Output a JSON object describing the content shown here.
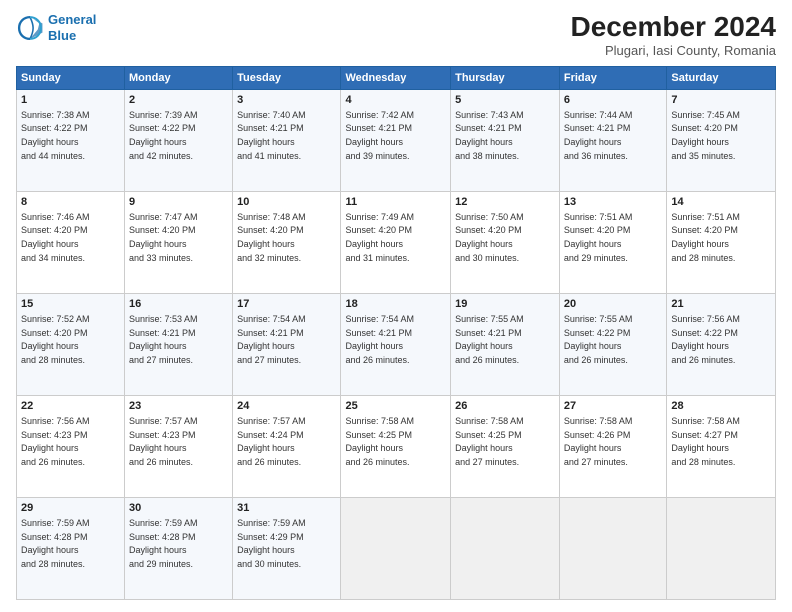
{
  "logo": {
    "line1": "General",
    "line2": "Blue"
  },
  "title": "December 2024",
  "subtitle": "Plugari, Iasi County, Romania",
  "header_days": [
    "Sunday",
    "Monday",
    "Tuesday",
    "Wednesday",
    "Thursday",
    "Friday",
    "Saturday"
  ],
  "weeks": [
    [
      {
        "day": "1",
        "sunrise": "7:38 AM",
        "sunset": "4:22 PM",
        "daylight": "8 hours and 44 minutes."
      },
      {
        "day": "2",
        "sunrise": "7:39 AM",
        "sunset": "4:22 PM",
        "daylight": "8 hours and 42 minutes."
      },
      {
        "day": "3",
        "sunrise": "7:40 AM",
        "sunset": "4:21 PM",
        "daylight": "8 hours and 41 minutes."
      },
      {
        "day": "4",
        "sunrise": "7:42 AM",
        "sunset": "4:21 PM",
        "daylight": "8 hours and 39 minutes."
      },
      {
        "day": "5",
        "sunrise": "7:43 AM",
        "sunset": "4:21 PM",
        "daylight": "8 hours and 38 minutes."
      },
      {
        "day": "6",
        "sunrise": "7:44 AM",
        "sunset": "4:21 PM",
        "daylight": "8 hours and 36 minutes."
      },
      {
        "day": "7",
        "sunrise": "7:45 AM",
        "sunset": "4:20 PM",
        "daylight": "8 hours and 35 minutes."
      }
    ],
    [
      {
        "day": "8",
        "sunrise": "7:46 AM",
        "sunset": "4:20 PM",
        "daylight": "8 hours and 34 minutes."
      },
      {
        "day": "9",
        "sunrise": "7:47 AM",
        "sunset": "4:20 PM",
        "daylight": "8 hours and 33 minutes."
      },
      {
        "day": "10",
        "sunrise": "7:48 AM",
        "sunset": "4:20 PM",
        "daylight": "8 hours and 32 minutes."
      },
      {
        "day": "11",
        "sunrise": "7:49 AM",
        "sunset": "4:20 PM",
        "daylight": "8 hours and 31 minutes."
      },
      {
        "day": "12",
        "sunrise": "7:50 AM",
        "sunset": "4:20 PM",
        "daylight": "8 hours and 30 minutes."
      },
      {
        "day": "13",
        "sunrise": "7:51 AM",
        "sunset": "4:20 PM",
        "daylight": "8 hours and 29 minutes."
      },
      {
        "day": "14",
        "sunrise": "7:51 AM",
        "sunset": "4:20 PM",
        "daylight": "8 hours and 28 minutes."
      }
    ],
    [
      {
        "day": "15",
        "sunrise": "7:52 AM",
        "sunset": "4:20 PM",
        "daylight": "8 hours and 28 minutes."
      },
      {
        "day": "16",
        "sunrise": "7:53 AM",
        "sunset": "4:21 PM",
        "daylight": "8 hours and 27 minutes."
      },
      {
        "day": "17",
        "sunrise": "7:54 AM",
        "sunset": "4:21 PM",
        "daylight": "8 hours and 27 minutes."
      },
      {
        "day": "18",
        "sunrise": "7:54 AM",
        "sunset": "4:21 PM",
        "daylight": "8 hours and 26 minutes."
      },
      {
        "day": "19",
        "sunrise": "7:55 AM",
        "sunset": "4:21 PM",
        "daylight": "8 hours and 26 minutes."
      },
      {
        "day": "20",
        "sunrise": "7:55 AM",
        "sunset": "4:22 PM",
        "daylight": "8 hours and 26 minutes."
      },
      {
        "day": "21",
        "sunrise": "7:56 AM",
        "sunset": "4:22 PM",
        "daylight": "8 hours and 26 minutes."
      }
    ],
    [
      {
        "day": "22",
        "sunrise": "7:56 AM",
        "sunset": "4:23 PM",
        "daylight": "8 hours and 26 minutes."
      },
      {
        "day": "23",
        "sunrise": "7:57 AM",
        "sunset": "4:23 PM",
        "daylight": "8 hours and 26 minutes."
      },
      {
        "day": "24",
        "sunrise": "7:57 AM",
        "sunset": "4:24 PM",
        "daylight": "8 hours and 26 minutes."
      },
      {
        "day": "25",
        "sunrise": "7:58 AM",
        "sunset": "4:25 PM",
        "daylight": "8 hours and 26 minutes."
      },
      {
        "day": "26",
        "sunrise": "7:58 AM",
        "sunset": "4:25 PM",
        "daylight": "8 hours and 27 minutes."
      },
      {
        "day": "27",
        "sunrise": "7:58 AM",
        "sunset": "4:26 PM",
        "daylight": "8 hours and 27 minutes."
      },
      {
        "day": "28",
        "sunrise": "7:58 AM",
        "sunset": "4:27 PM",
        "daylight": "8 hours and 28 minutes."
      }
    ],
    [
      {
        "day": "29",
        "sunrise": "7:59 AM",
        "sunset": "4:28 PM",
        "daylight": "8 hours and 28 minutes."
      },
      {
        "day": "30",
        "sunrise": "7:59 AM",
        "sunset": "4:28 PM",
        "daylight": "8 hours and 29 minutes."
      },
      {
        "day": "31",
        "sunrise": "7:59 AM",
        "sunset": "4:29 PM",
        "daylight": "8 hours and 30 minutes."
      },
      null,
      null,
      null,
      null
    ]
  ]
}
